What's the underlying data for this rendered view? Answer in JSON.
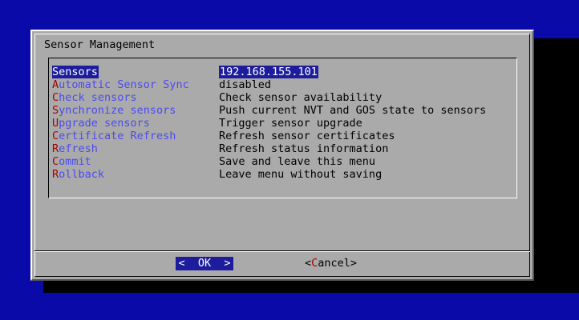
{
  "dialog": {
    "title": "Sensor Management",
    "menu": [
      {
        "hotkey": "S",
        "rest": "ensors",
        "description": "192.168.155.101",
        "selected": true
      },
      {
        "hotkey": "A",
        "rest": "utomatic Sensor Sync",
        "description": "disabled",
        "selected": false
      },
      {
        "hotkey": "C",
        "rest": "heck sensors",
        "description": "Check sensor availability",
        "selected": false
      },
      {
        "hotkey": "S",
        "rest": "ynchronize sensors",
        "description": "Push current NVT and GOS state to sensors",
        "selected": false
      },
      {
        "hotkey": "U",
        "rest": "pgrade sensors",
        "description": "Trigger sensor upgrade",
        "selected": false
      },
      {
        "hotkey": "C",
        "rest": "ertificate Refresh",
        "description": "Refresh sensor certificates",
        "selected": false
      },
      {
        "hotkey": "R",
        "rest": "efresh",
        "description": "Refresh status information",
        "selected": false
      },
      {
        "hotkey": "C",
        "rest": "ommit",
        "description": "Save and leave this menu",
        "selected": false
      },
      {
        "hotkey": "R",
        "rest": "ollback",
        "description": "Leave menu without saving",
        "selected": false
      }
    ],
    "buttons": {
      "ok_label": "<  OK  >",
      "cancel_open": "<",
      "cancel_hotkey": "C",
      "cancel_rest": "ancel",
      "cancel_close": ">"
    }
  },
  "colors": {
    "background": "#0a0aa8",
    "dialog": "#aaaaaa",
    "selection": "#1c1c9c",
    "tag_text": "#4b4bf0",
    "hotkey": "#a80000"
  }
}
